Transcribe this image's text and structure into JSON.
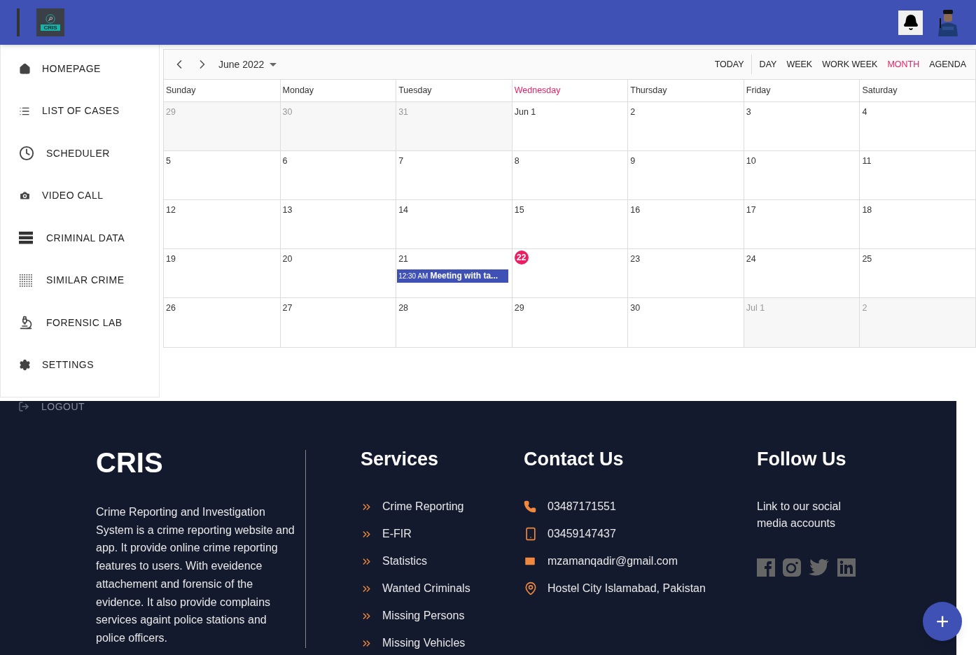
{
  "header": {
    "logo_text": "CRIS"
  },
  "sidebar": {
    "items": [
      {
        "label": "HOMEPAGE"
      },
      {
        "label": "LIST OF CASES"
      },
      {
        "label": "SCHEDULER"
      },
      {
        "label": "VIDEO CALL"
      },
      {
        "label": "CRIMINAL DATA"
      },
      {
        "label": "SIMILAR CRIME"
      },
      {
        "label": "FORENSIC LAB"
      },
      {
        "label": "SETTINGS"
      }
    ],
    "logout": "LOGOUT"
  },
  "calendar": {
    "period": "June 2022",
    "today_button": "TODAY",
    "views": [
      {
        "label": "DAY",
        "selected": false
      },
      {
        "label": "WEEK",
        "selected": false
      },
      {
        "label": "WORK WEEK",
        "selected": false
      },
      {
        "label": "MONTH",
        "selected": true
      },
      {
        "label": "AGENDA",
        "selected": false
      }
    ],
    "weekdays": [
      {
        "label": "Sunday",
        "today": false
      },
      {
        "label": "Monday",
        "today": false
      },
      {
        "label": "Tuesday",
        "today": false
      },
      {
        "label": "Wednesday",
        "today": true
      },
      {
        "label": "Thursday",
        "today": false
      },
      {
        "label": "Friday",
        "today": false
      },
      {
        "label": "Saturday",
        "today": false
      }
    ],
    "weeks": [
      [
        {
          "label": "29",
          "off_range": true,
          "today": false
        },
        {
          "label": "30",
          "off_range": true,
          "today": false
        },
        {
          "label": "31",
          "off_range": true,
          "today": false
        },
        {
          "label": "Jun 1",
          "off_range": false,
          "today": false
        },
        {
          "label": "2",
          "off_range": false,
          "today": false
        },
        {
          "label": "3",
          "off_range": false,
          "today": false
        },
        {
          "label": "4",
          "off_range": false,
          "today": false
        }
      ],
      [
        {
          "label": "5",
          "off_range": false,
          "today": false
        },
        {
          "label": "6",
          "off_range": false,
          "today": false
        },
        {
          "label": "7",
          "off_range": false,
          "today": false
        },
        {
          "label": "8",
          "off_range": false,
          "today": false
        },
        {
          "label": "9",
          "off_range": false,
          "today": false
        },
        {
          "label": "10",
          "off_range": false,
          "today": false
        },
        {
          "label": "11",
          "off_range": false,
          "today": false
        }
      ],
      [
        {
          "label": "12",
          "off_range": false,
          "today": false
        },
        {
          "label": "13",
          "off_range": false,
          "today": false
        },
        {
          "label": "14",
          "off_range": false,
          "today": false
        },
        {
          "label": "15",
          "off_range": false,
          "today": false
        },
        {
          "label": "16",
          "off_range": false,
          "today": false
        },
        {
          "label": "17",
          "off_range": false,
          "today": false
        },
        {
          "label": "18",
          "off_range": false,
          "today": false
        }
      ],
      [
        {
          "label": "19",
          "off_range": false,
          "today": false
        },
        {
          "label": "20",
          "off_range": false,
          "today": false
        },
        {
          "label": "21",
          "off_range": false,
          "today": false,
          "events": [
            {
              "time": "12:30 AM",
              "title": "Meeting with ta..."
            }
          ]
        },
        {
          "label": "22",
          "off_range": false,
          "today": true
        },
        {
          "label": "23",
          "off_range": false,
          "today": false
        },
        {
          "label": "24",
          "off_range": false,
          "today": false
        },
        {
          "label": "25",
          "off_range": false,
          "today": false
        }
      ],
      [
        {
          "label": "26",
          "off_range": false,
          "today": false
        },
        {
          "label": "27",
          "off_range": false,
          "today": false
        },
        {
          "label": "28",
          "off_range": false,
          "today": false
        },
        {
          "label": "29",
          "off_range": false,
          "today": false
        },
        {
          "label": "30",
          "off_range": false,
          "today": false
        },
        {
          "label": "Jul 1",
          "off_range": true,
          "today": false
        },
        {
          "label": "2",
          "off_range": true,
          "today": false
        }
      ]
    ]
  },
  "footer": {
    "brand": "CRIS",
    "about": "Crime Reporting and Investigation System is a crime reporting website and app. It provide online crime reporting features to users. With eveidence attachement and forensic of the evidence. It also provide complains services againt police stations and police officers.",
    "services_title": "Services",
    "services": [
      "Crime Reporting",
      "E-FIR",
      "Statistics",
      "Wanted Criminals",
      "Missing Persons",
      "Missing Vehicles"
    ],
    "contact_title": "Contact Us",
    "contacts": [
      {
        "kind": "phone",
        "text": "03487171551"
      },
      {
        "kind": "mobile",
        "text": "03459147437"
      },
      {
        "kind": "email",
        "text": "mzamanqadir@gmail.com"
      },
      {
        "kind": "location",
        "text": "Hostel City Islamabad, Pakistan"
      }
    ],
    "follow_title": "Follow Us",
    "follow_text": "Link to our social media accounts"
  },
  "fab": {
    "label": "+"
  }
}
